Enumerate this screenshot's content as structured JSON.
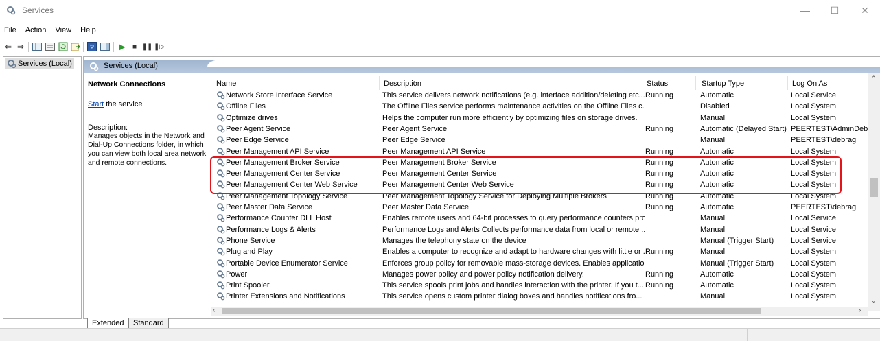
{
  "window": {
    "title": "Services",
    "minimize_icon": "minimize-icon",
    "maximize_icon": "maximize-icon",
    "close_icon": "close-icon"
  },
  "menu": [
    "File",
    "Action",
    "View",
    "Help"
  ],
  "toolbar_icons": [
    "back-arrow-icon",
    "forward-arrow-icon",
    "console-tree-icon",
    "properties-icon",
    "refresh-icon",
    "export-list-icon",
    "help-icon",
    "show-hide-icon",
    "start-service-icon",
    "stop-service-icon",
    "pause-service-icon",
    "restart-service-icon"
  ],
  "tree": {
    "root": "Services (Local)"
  },
  "pane": {
    "header": "Services (Local)",
    "selected_name": "Network Connections",
    "start_link": "Start",
    "start_suffix": " the service",
    "description_label": "Description:",
    "description_text": "Manages objects in the Network and Dial-Up Connections folder, in which you can view both local area network and remote connections."
  },
  "columns": {
    "name": "Name",
    "description": "Description",
    "status": "Status",
    "startup": "Startup Type",
    "logon": "Log On As"
  },
  "rows": [
    {
      "name": "Network Store Interface Service",
      "description": "This service delivers network notifications (e.g. interface addition/deleting etc...",
      "status": "Running",
      "startup": "Automatic",
      "logon": "Local Service"
    },
    {
      "name": "Offline Files",
      "description": "The Offline Files service performs maintenance activities on the Offline Files c...",
      "status": "",
      "startup": "Disabled",
      "logon": "Local System"
    },
    {
      "name": "Optimize drives",
      "description": "Helps the computer run more efficiently by optimizing files on storage drives.",
      "status": "",
      "startup": "Manual",
      "logon": "Local System"
    },
    {
      "name": "Peer Agent Service",
      "description": "Peer Agent Service",
      "status": "Running",
      "startup": "Automatic (Delayed Start)",
      "logon": "PEERTEST\\AdminDebrag"
    },
    {
      "name": "Peer Edge Service",
      "description": "Peer Edge Service",
      "status": "",
      "startup": "Manual",
      "logon": "PEERTEST\\debrag"
    },
    {
      "name": "Peer Management API Service",
      "description": "Peer Management API Service",
      "status": "Running",
      "startup": "Automatic",
      "logon": "Local System"
    },
    {
      "name": "Peer Management Broker Service",
      "description": "Peer Management Broker Service",
      "status": "Running",
      "startup": "Automatic",
      "logon": "Local System"
    },
    {
      "name": "Peer Management Center Service",
      "description": "Peer Management Center Service",
      "status": "Running",
      "startup": "Automatic",
      "logon": "Local System"
    },
    {
      "name": "Peer Management Center Web Service",
      "description": "Peer Management Center Web Service",
      "status": "Running",
      "startup": "Automatic",
      "logon": "Local System"
    },
    {
      "name": "Peer Management Topology Service",
      "description": "Peer Management Topology Service for Deploying Multiple Brokers",
      "status": "Running",
      "startup": "Automatic",
      "logon": "Local System"
    },
    {
      "name": "Peer Master Data Service",
      "description": "Peer Master Data Service",
      "status": "Running",
      "startup": "Automatic",
      "logon": "PEERTEST\\debrag"
    },
    {
      "name": "Performance Counter DLL Host",
      "description": "Enables remote users and 64-bit processes to query performance counters pro...",
      "status": "",
      "startup": "Manual",
      "logon": "Local Service"
    },
    {
      "name": "Performance Logs & Alerts",
      "description": "Performance Logs and Alerts Collects performance data from local or remote ...",
      "status": "",
      "startup": "Manual",
      "logon": "Local Service"
    },
    {
      "name": "Phone Service",
      "description": "Manages the telephony state on the device",
      "status": "",
      "startup": "Manual (Trigger Start)",
      "logon": "Local Service"
    },
    {
      "name": "Plug and Play",
      "description": "Enables a computer to recognize and adapt to hardware changes with little or ...",
      "status": "Running",
      "startup": "Manual",
      "logon": "Local System"
    },
    {
      "name": "Portable Device Enumerator Service",
      "description": "Enforces group policy for removable mass-storage devices. Enables applicatio...",
      "status": "",
      "startup": "Manual (Trigger Start)",
      "logon": "Local System"
    },
    {
      "name": "Power",
      "description": "Manages power policy and power policy notification delivery.",
      "status": "Running",
      "startup": "Automatic",
      "logon": "Local System"
    },
    {
      "name": "Print Spooler",
      "description": "This service spools print jobs and handles interaction with the printer.  If you t...",
      "status": "Running",
      "startup": "Automatic",
      "logon": "Local System"
    },
    {
      "name": "Printer Extensions and Notifications",
      "description": "This service opens custom printer dialog boxes and handles notifications fro...",
      "status": "",
      "startup": "Manual",
      "logon": "Local System"
    }
  ],
  "tabs": [
    "Extended",
    "Standard"
  ],
  "colors": {
    "highlight": "#e4141b",
    "pane_header": "#9fb4d0",
    "link": "#0645ad"
  }
}
